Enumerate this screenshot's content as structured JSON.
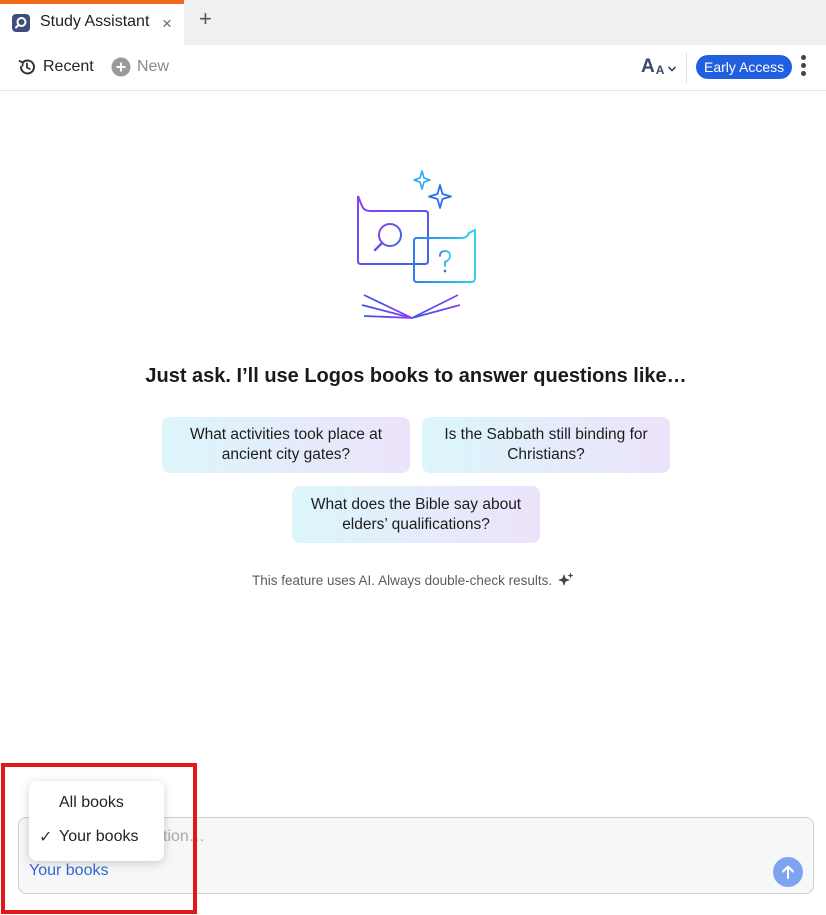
{
  "tab": {
    "title": "Study Assistant",
    "close_glyph": "×",
    "add_glyph": "+",
    "icon": "logos-search-icon",
    "accent": "#f26b1d"
  },
  "toolbar": {
    "recent_label": "Recent",
    "new_label": "New",
    "font_big": "A",
    "font_small": "A",
    "early_access_label": "Early Access",
    "early_access_color": "#1f5fe0"
  },
  "main": {
    "headline": "Just ask. I’ll use Logos books to answer questions like…",
    "suggestions": [
      {
        "text": "What activities took place at ancient city gates?"
      },
      {
        "text": "Is the Sabbath still binding for Christians?"
      },
      {
        "text": "What does the Bible say about elders’ qualifications?"
      }
    ],
    "disclaimer": "This feature uses AI. Always double-check results."
  },
  "input": {
    "placeholder_visible": "tion…",
    "scope_label": "Your books"
  },
  "scope_menu": {
    "options": [
      {
        "label": "All books",
        "selected": false
      },
      {
        "label": "Your books",
        "selected": true
      }
    ],
    "check_glyph": "✓"
  }
}
